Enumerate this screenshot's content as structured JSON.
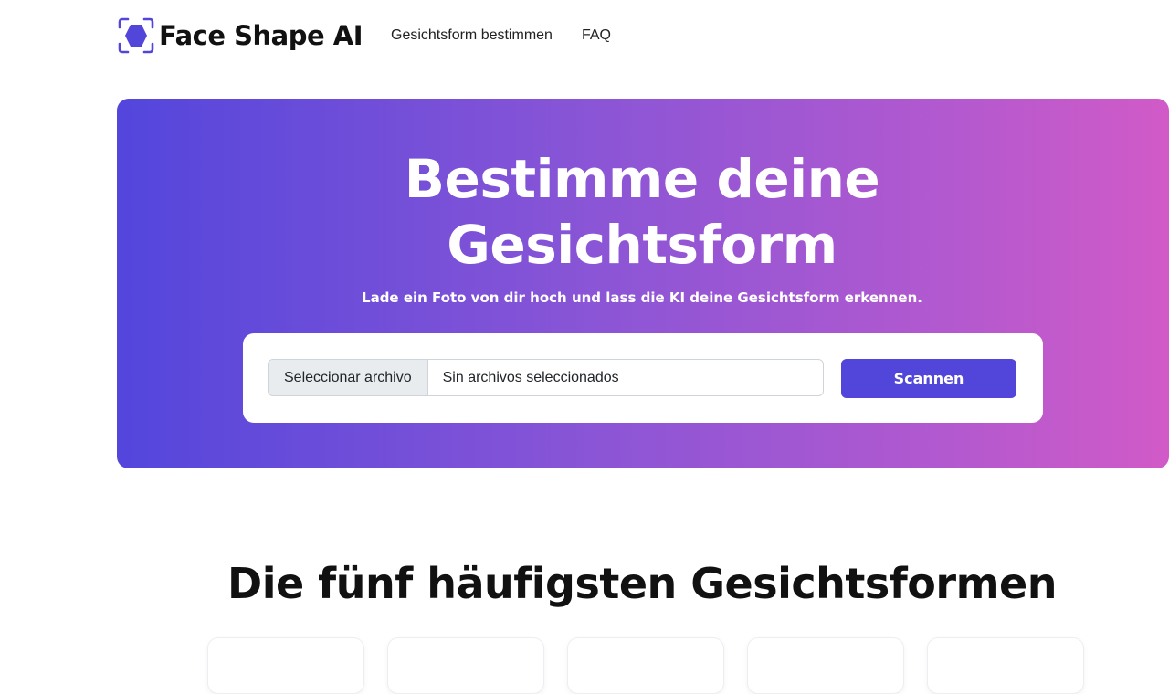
{
  "header": {
    "brand": "Face Shape AI",
    "nav": [
      "Gesichtsform bestimmen",
      "FAQ"
    ]
  },
  "hero": {
    "title_line1": "Bestimme deine",
    "title_line2": "Gesichtsform",
    "subtitle": "Lade ein Foto von dir hoch und lass die KI deine Gesichtsform erkennen.",
    "file_button": "Seleccionar archivo",
    "file_status": "Sin archivos seleccionados",
    "scan_button": "Scannen"
  },
  "section": {
    "title": "Die fünf häufigsten Gesichtsformen"
  },
  "colors": {
    "accent": "#5245d9",
    "gradient_start": "#5346dc",
    "gradient_end": "#d15ac7"
  }
}
